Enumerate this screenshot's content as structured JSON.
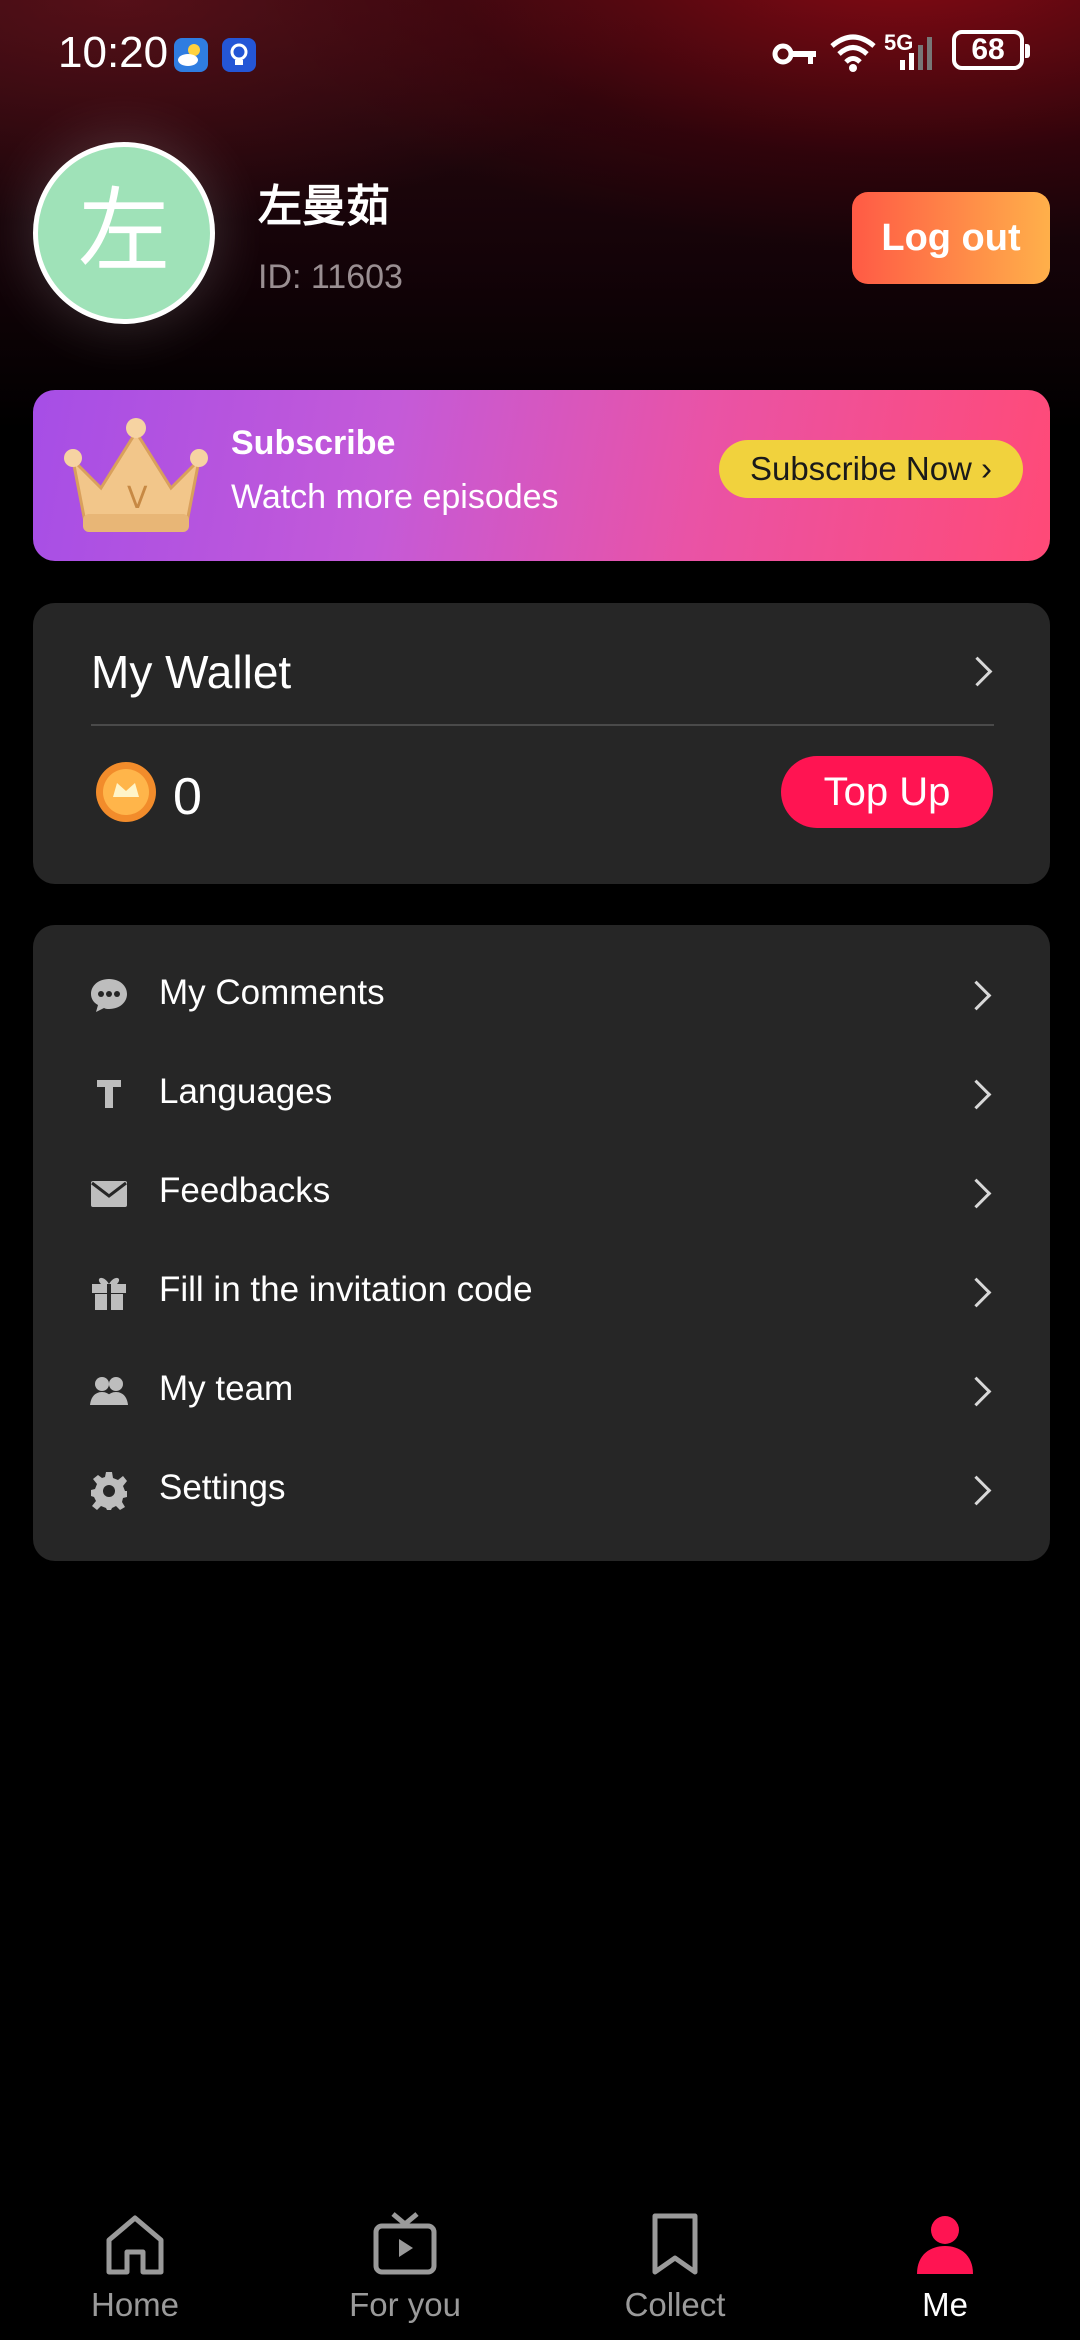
{
  "status_bar": {
    "time": "10:20",
    "network": "5G",
    "battery": "68"
  },
  "profile": {
    "avatar_char": "左",
    "username": "左曼茹",
    "user_id": "ID: 11603",
    "logout_label": "Log out"
  },
  "subscribe_banner": {
    "title": "Subscribe",
    "subtitle": "Watch more episodes",
    "button_label": "Subscribe Now ›"
  },
  "wallet": {
    "title": "My Wallet",
    "balance": "0",
    "topup_label": "Top Up"
  },
  "menu": {
    "items": [
      {
        "label": "My Comments",
        "icon": "chat-bubble-icon"
      },
      {
        "label": "Languages",
        "icon": "text-t-icon"
      },
      {
        "label": "Feedbacks",
        "icon": "envelope-icon"
      },
      {
        "label": "Fill in the invitation code",
        "icon": "gift-icon"
      },
      {
        "label": "My team",
        "icon": "team-icon"
      },
      {
        "label": "Settings",
        "icon": "gear-icon"
      }
    ]
  },
  "bottom_nav": {
    "items": [
      {
        "label": "Home",
        "icon": "home-icon"
      },
      {
        "label": "For you",
        "icon": "tv-play-icon"
      },
      {
        "label": "Collect",
        "icon": "bookmark-icon"
      },
      {
        "label": "Me",
        "icon": "person-icon",
        "active": true
      }
    ]
  },
  "colors": {
    "accent": "#ff1452",
    "card": "#262626",
    "subscribe_button": "#f1d23d"
  }
}
